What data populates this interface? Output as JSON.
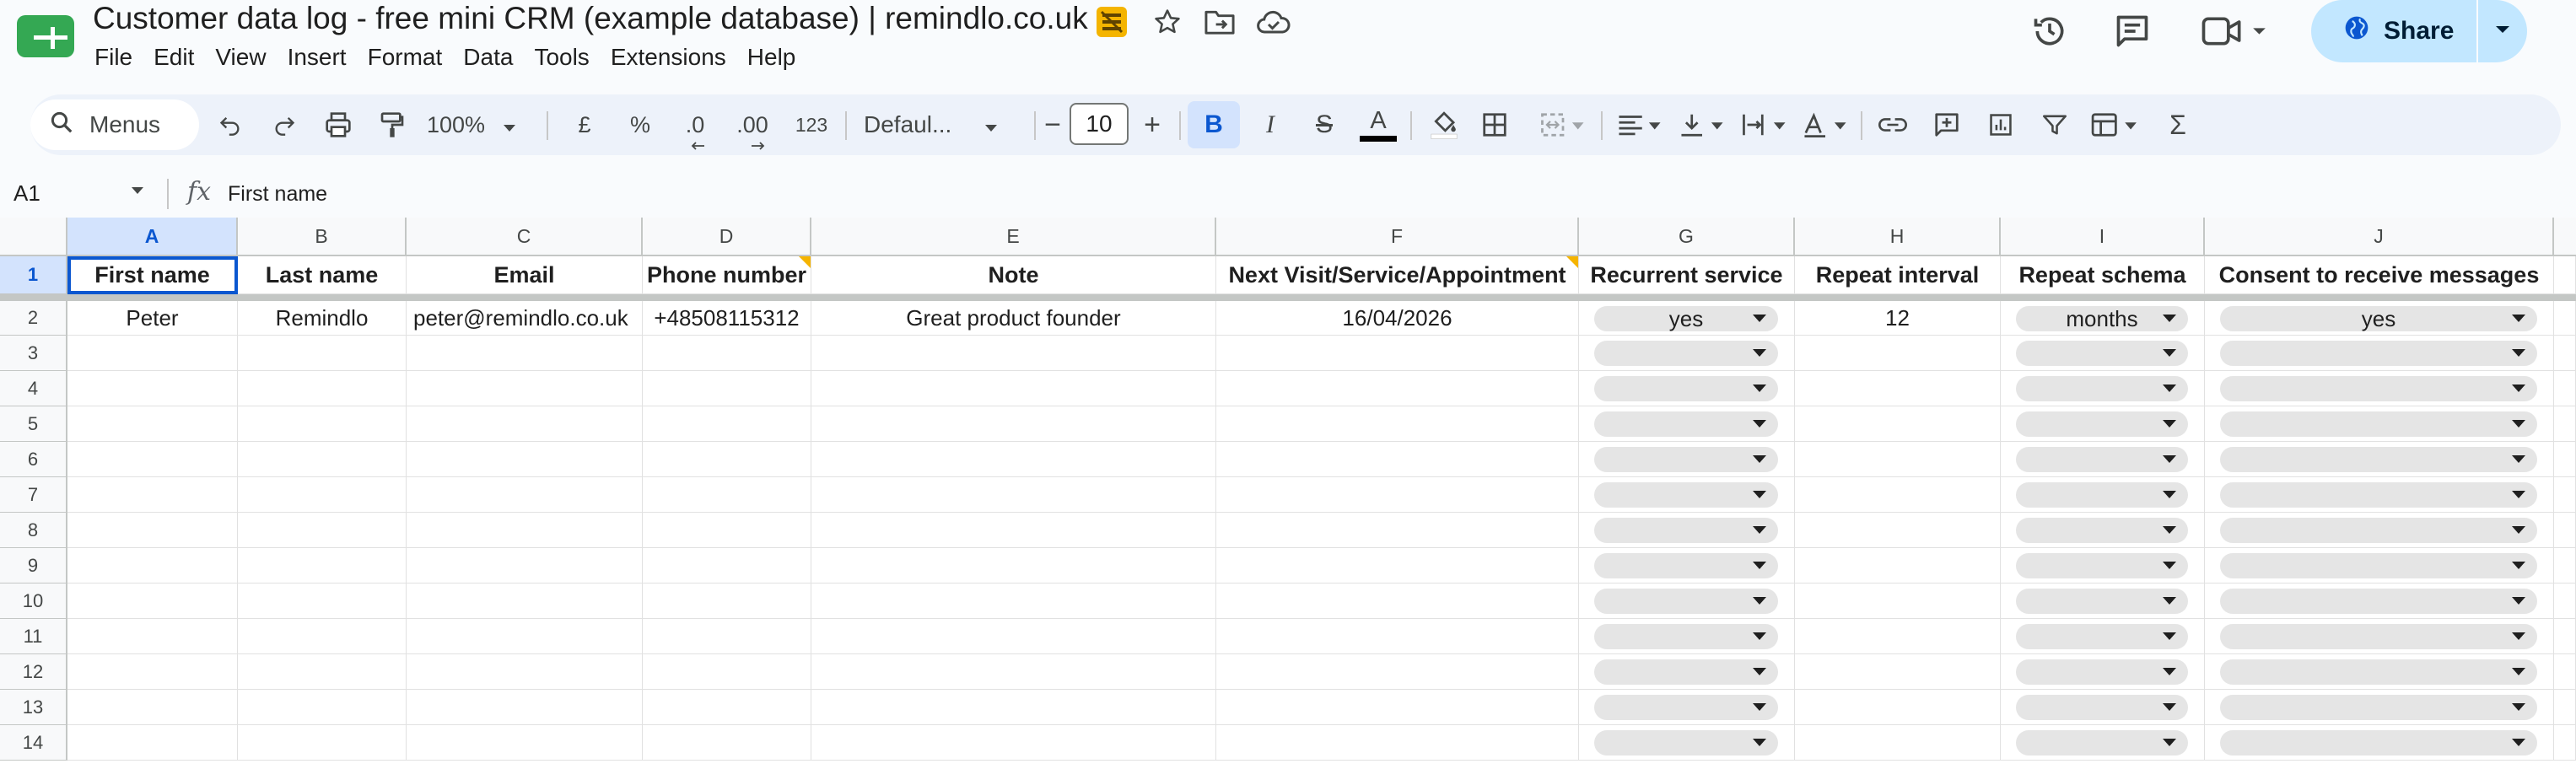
{
  "app": {
    "title": "Customer data log - free mini CRM (example database) | remindlo.co.uk",
    "icons": [
      "sheets-logo",
      "sheet-status-icon",
      "star-icon",
      "move-to-folder-icon",
      "cloud-saved-icon",
      "version-history-icon",
      "comments-icon",
      "meet-icon",
      "globe-icon"
    ]
  },
  "menu": [
    "File",
    "Edit",
    "View",
    "Insert",
    "Format",
    "Data",
    "Tools",
    "Extensions",
    "Help"
  ],
  "share": {
    "label": "Share"
  },
  "toolbar": {
    "search_label": "Menus",
    "zoom": "100%",
    "currency": "£",
    "percent": "%",
    "dec_minus": ".0",
    "dec_plus": ".00",
    "number_format": "123",
    "font": "Defaul...",
    "font_size": "10",
    "minus": "−",
    "plus": "+",
    "bold": "B",
    "italic": "I",
    "strike": "S",
    "text_color_letter": "A",
    "text_color": "#000000",
    "functions": "Σ"
  },
  "formula_bar": {
    "cell_ref": "A1",
    "fx": "fx",
    "value": "First name"
  },
  "grid": {
    "columns": [
      "A",
      "B",
      "C",
      "D",
      "E",
      "F",
      "G",
      "H",
      "I",
      "J"
    ],
    "rows": [
      "1",
      "2",
      "3",
      "4",
      "5",
      "6",
      "7",
      "8",
      "9",
      "10",
      "11",
      "12",
      "13",
      "14"
    ],
    "headers": [
      "First name",
      "Last name",
      "Email",
      "Phone number",
      "Note",
      "Next Visit/Service/Appointment",
      "Recurrent service",
      "Repeat interval",
      "Repeat schema",
      "Consent to receive messages"
    ],
    "row2": {
      "first_name": "Peter",
      "last_name": "Remindlo",
      "email": "peter@remindlo.co.uk",
      "phone": "+48508115312",
      "note": "Great product founder",
      "next_visit": "16/04/2026",
      "recurrent": "yes",
      "interval": "12",
      "schema": "months",
      "consent": "yes"
    }
  },
  "colors": {
    "accent": "#0b57d0",
    "share_bg": "#c2e7ff",
    "chip_bg": "#e5e5e5",
    "note_marker": "#f5b400"
  }
}
